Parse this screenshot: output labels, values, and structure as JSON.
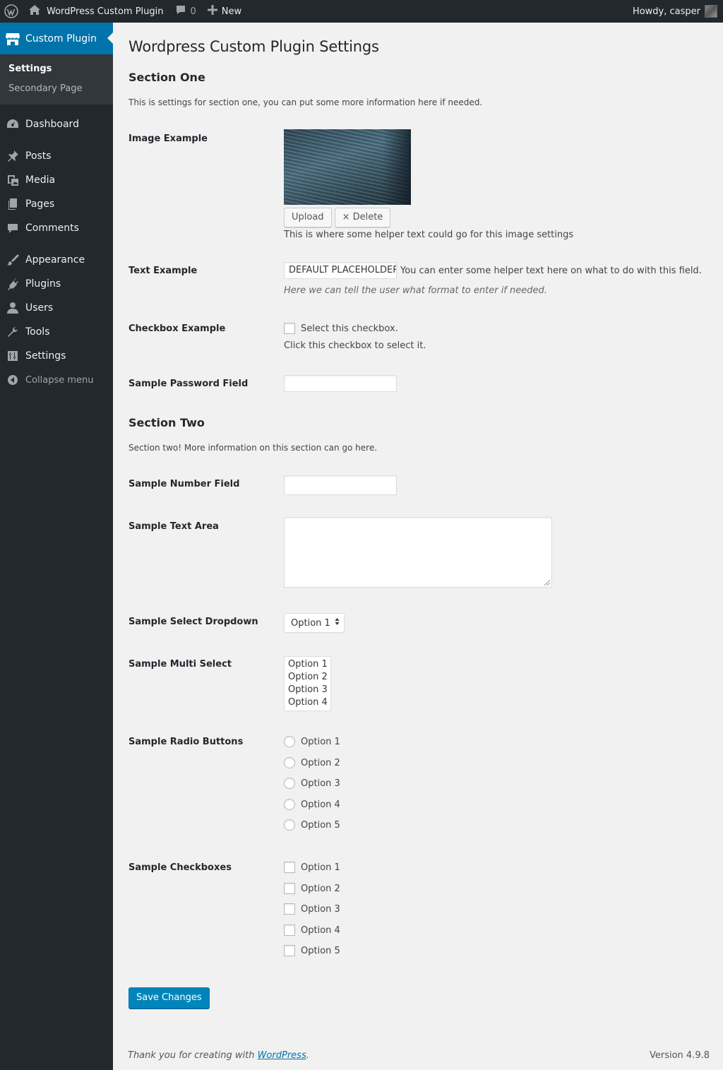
{
  "adminbar": {
    "site_name": "WordPress Custom Plugin",
    "comments_count": "0",
    "new_label": "New",
    "howdy": "Howdy, casper"
  },
  "sidebar": {
    "current": "Custom Plugin",
    "submenu": [
      "Settings",
      "Secondary Page"
    ],
    "items": {
      "dashboard": "Dashboard",
      "posts": "Posts",
      "media": "Media",
      "pages": "Pages",
      "comments": "Comments",
      "appearance": "Appearance",
      "plugins": "Plugins",
      "users": "Users",
      "tools": "Tools",
      "settings": "Settings",
      "collapse": "Collapse menu"
    }
  },
  "page": {
    "title": "Wordpress Custom Plugin Settings",
    "section_one": {
      "title": "Section One",
      "desc": "This is settings for section one, you can put some more information here if needed.",
      "image_label": "Image Example",
      "upload": "Upload",
      "delete": "× Delete",
      "image_help": "This is where some helper text could go for this image settings",
      "text_label": "Text Example",
      "text_value": "DEFAULT PLACEHOLDER",
      "text_help": "You can enter some helper text here on what to do with this field.",
      "text_format": "Here we can tell the user what format to enter if needed.",
      "checkbox_label": "Checkbox Example",
      "checkbox_text": "Select this checkbox.",
      "checkbox_help": "Click this checkbox to select it.",
      "password_label": "Sample Password Field"
    },
    "section_two": {
      "title": "Section Two",
      "desc": "Section two! More information on this section can go here.",
      "number_label": "Sample Number Field",
      "textarea_label": "Sample Text Area",
      "select_label": "Sample Select Dropdown",
      "select_value": "Option 1",
      "multi_label": "Sample Multi Select",
      "multi_options": [
        "Option 1",
        "Option 2",
        "Option 3",
        "Option 4"
      ],
      "radio_label": "Sample Radio Buttons",
      "radio_options": [
        "Option 1",
        "Option 2",
        "Option 3",
        "Option 4",
        "Option 5"
      ],
      "checkboxes_label": "Sample Checkboxes",
      "checkbox_options": [
        "Option 1",
        "Option 2",
        "Option 3",
        "Option 4",
        "Option 5"
      ]
    },
    "save": "Save Changes"
  },
  "footer": {
    "thanks": "Thank you for creating with ",
    "link": "WordPress",
    "period": ".",
    "version": "Version 4.9.8"
  },
  "colors": {
    "admin_dark": "#23282d",
    "accent": "#0073aa",
    "primary_button": "#0085ba",
    "content_bg": "#f1f1f1"
  }
}
